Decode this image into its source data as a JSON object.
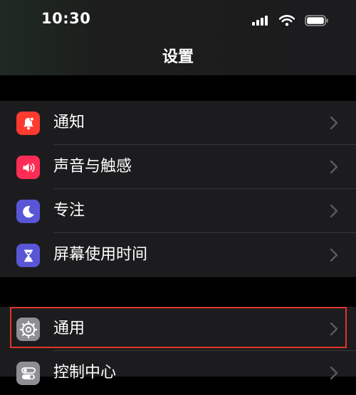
{
  "status_bar": {
    "time": "10:30"
  },
  "nav": {
    "title": "设置"
  },
  "groups": [
    {
      "items": [
        {
          "label": "通知",
          "icon": "bell-icon",
          "color": "#ff3b30"
        },
        {
          "label": "声音与触感",
          "icon": "speaker-icon",
          "color": "#ff2d55"
        },
        {
          "label": "专注",
          "icon": "moon-icon",
          "color": "#5856d6"
        },
        {
          "label": "屏幕使用时间",
          "icon": "hourglass-icon",
          "color": "#5856d6"
        }
      ]
    },
    {
      "items": [
        {
          "label": "通用",
          "icon": "gear-icon",
          "color": "#8e8e93"
        },
        {
          "label": "控制中心",
          "icon": "toggles-icon",
          "color": "#8e8e93"
        }
      ]
    }
  ],
  "highlight": {
    "color": "#e0352b",
    "target": "通用"
  },
  "colors": {
    "background": "#000000",
    "cell": "#1c1c1e",
    "separator": "#38383a",
    "chevron": "#5a5a5f"
  }
}
